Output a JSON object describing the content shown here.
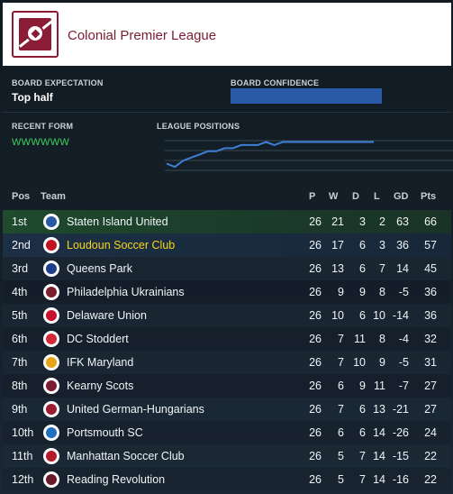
{
  "header": {
    "league_name": "Colonial Premier League",
    "logo": "league-crest-ball-icon"
  },
  "board": {
    "expectation_label": "BOARD EXPECTATION",
    "expectation_value": "Top half",
    "confidence_label": "BOARD CONFIDENCE",
    "confidence_level": 1.0
  },
  "form": {
    "recent_label": "RECENT FORM",
    "recent_value": "WWWWWW",
    "positions_label": "LEAGUE POSITIONS",
    "positions_series": [
      9,
      10,
      8,
      7,
      6,
      5,
      5,
      4,
      4,
      3,
      3,
      3,
      2,
      3,
      2,
      2,
      2,
      2,
      2,
      2,
      2,
      2,
      2,
      2,
      2,
      2
    ]
  },
  "table": {
    "headers": {
      "pos": "Pos",
      "team": "Team",
      "p": "P",
      "w": "W",
      "d": "D",
      "l": "L",
      "gd": "GD",
      "pts": "Pts"
    },
    "rows": [
      {
        "pos": "1st",
        "team": "Staten Island United",
        "p": "26",
        "w": "21",
        "d": "3",
        "l": "2",
        "gd": "63",
        "pts": "66",
        "crest_color": "#2a5aa6"
      },
      {
        "pos": "2nd",
        "team": "Loudoun Soccer Club",
        "p": "26",
        "w": "17",
        "d": "6",
        "l": "3",
        "gd": "36",
        "pts": "57",
        "crest_color": "#c1121f"
      },
      {
        "pos": "3rd",
        "team": "Queens Park",
        "p": "26",
        "w": "13",
        "d": "6",
        "l": "7",
        "gd": "14",
        "pts": "45",
        "crest_color": "#1d3f8a"
      },
      {
        "pos": "4th",
        "team": "Philadelphia Ukrainians",
        "p": "26",
        "w": "9",
        "d": "9",
        "l": "8",
        "gd": "-5",
        "pts": "36",
        "crest_color": "#7a1f2b"
      },
      {
        "pos": "5th",
        "team": "Delaware Union",
        "p": "26",
        "w": "10",
        "d": "6",
        "l": "10",
        "gd": "-14",
        "pts": "36",
        "crest_color": "#c8102e"
      },
      {
        "pos": "6th",
        "team": "DC Stoddert",
        "p": "26",
        "w": "7",
        "d": "11",
        "l": "8",
        "gd": "-4",
        "pts": "32",
        "crest_color": "#d62839"
      },
      {
        "pos": "7th",
        "team": "IFK Maryland",
        "p": "26",
        "w": "7",
        "d": "10",
        "l": "9",
        "gd": "-5",
        "pts": "31",
        "crest_color": "#e8a317"
      },
      {
        "pos": "8th",
        "team": "Kearny Scots",
        "p": "26",
        "w": "6",
        "d": "9",
        "l": "11",
        "gd": "-7",
        "pts": "27",
        "crest_color": "#7b1c33"
      },
      {
        "pos": "9th",
        "team": "United German-Hungarians",
        "p": "26",
        "w": "7",
        "d": "6",
        "l": "13",
        "gd": "-21",
        "pts": "27",
        "crest_color": "#9b1b30"
      },
      {
        "pos": "10th",
        "team": "Portsmouth SC",
        "p": "26",
        "w": "6",
        "d": "6",
        "l": "14",
        "gd": "-26",
        "pts": "24",
        "crest_color": "#1f6fc2"
      },
      {
        "pos": "11th",
        "team": "Manhattan Soccer Club",
        "p": "26",
        "w": "5",
        "d": "7",
        "l": "14",
        "gd": "-15",
        "pts": "22",
        "crest_color": "#b31b2c"
      },
      {
        "pos": "12th",
        "team": "Reading Revolution",
        "p": "26",
        "w": "5",
        "d": "7",
        "l": "14",
        "gd": "-16",
        "pts": "22",
        "crest_color": "#6b1a2a"
      }
    ]
  },
  "highlight_team_color": "#f7d61c"
}
